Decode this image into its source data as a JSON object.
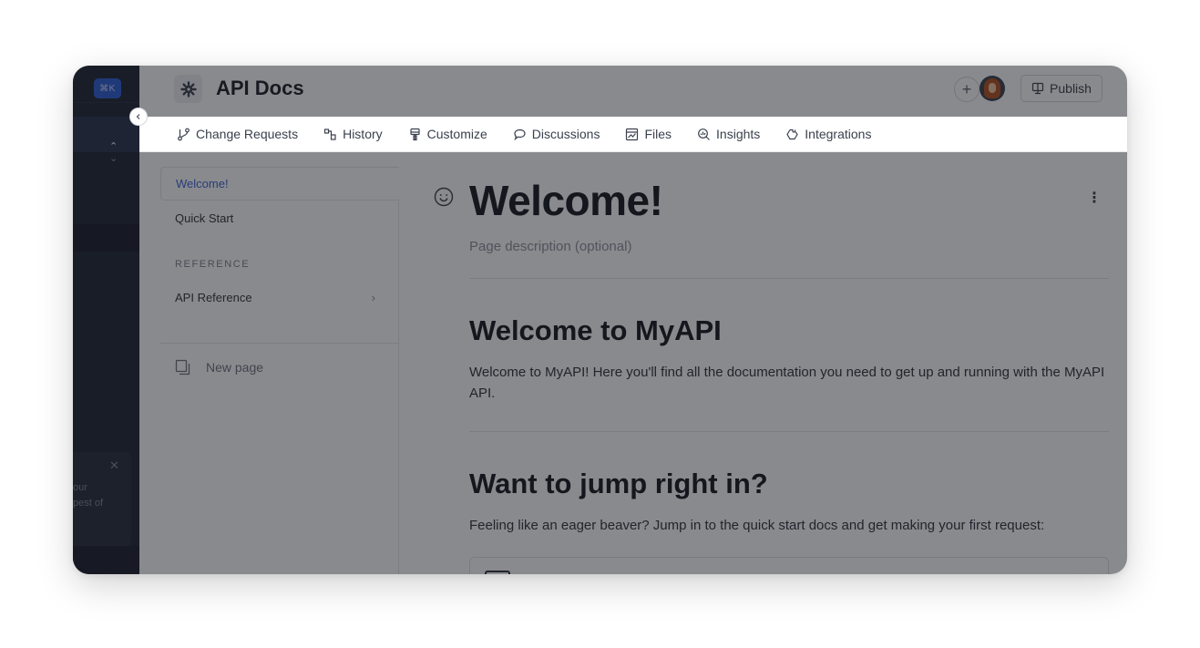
{
  "sidebar": {
    "shortcut": "⌘K",
    "toast_text": "our\npest of"
  },
  "header": {
    "space_title": "API Docs",
    "publish_label": "Publish"
  },
  "tabs": [
    {
      "label": "Change Requests",
      "icon": "branch-icon"
    },
    {
      "label": "History",
      "icon": "history-icon"
    },
    {
      "label": "Customize",
      "icon": "paint-brush-icon"
    },
    {
      "label": "Discussions",
      "icon": "chat-bubble-icon"
    },
    {
      "label": "Files",
      "icon": "image-file-icon"
    },
    {
      "label": "Insights",
      "icon": "magnify-chart-icon"
    },
    {
      "label": "Integrations",
      "icon": "puzzle-icon"
    }
  ],
  "tree": {
    "items": [
      {
        "label": "Welcome!"
      },
      {
        "label": "Quick Start"
      }
    ],
    "section_label": "REFERENCE",
    "api_reference": "API Reference",
    "new_page": "New page"
  },
  "page": {
    "title": "Welcome!",
    "description": "Page description (optional)",
    "h2_welcome": "Welcome to MyAPI",
    "p_welcome": "Welcome to MyAPI! Here you'll find all the documentation you need to get up and running with the MyAPI API.",
    "h2_jump": "Want to jump right in?",
    "p_jump": "Feeling like an eager beaver? Jump in to the quick start docs and get making your first request:"
  },
  "colors": {
    "accent": "#3d63d6",
    "sidebar_dark": "#1e2433",
    "overlay": "rgba(20,22,28,0.5)"
  }
}
